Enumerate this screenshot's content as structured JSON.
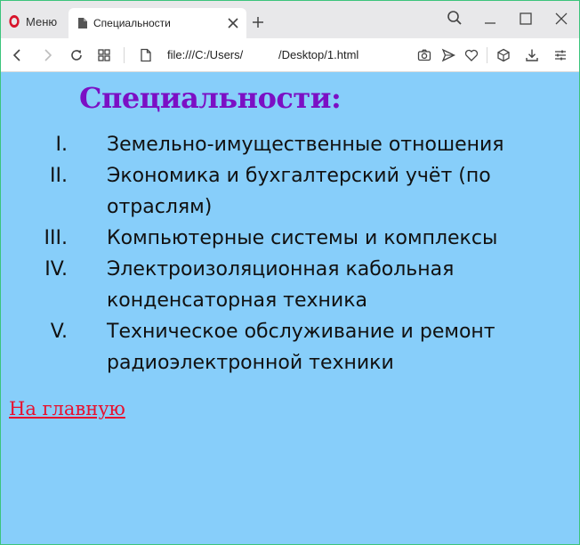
{
  "browser": {
    "menu_label": "Меню",
    "tab_title": "Специальности",
    "url": "file:///C:/Users/           /Desktop/1.html",
    "accent_color": "#d8142b"
  },
  "page": {
    "heading": "Специальности:",
    "heading_color": "#7b0fc4",
    "background_color": "#87cefa",
    "items": [
      {
        "num": "I.",
        "text": "Земельно-имущественные отношения"
      },
      {
        "num": "II.",
        "text": "Экономика и бухгалтерский учёт (по отраслям)"
      },
      {
        "num": "III.",
        "text": "Компьютерные системы и комплексы"
      },
      {
        "num": "IV.",
        "text": "Электроизоляционная кабольная конденсаторная техника"
      },
      {
        "num": "V.",
        "text": "Техническое обслуживание и ремонт радиоэлектронной техники"
      }
    ],
    "home_link": "На главную",
    "link_color": "#e8102e"
  }
}
